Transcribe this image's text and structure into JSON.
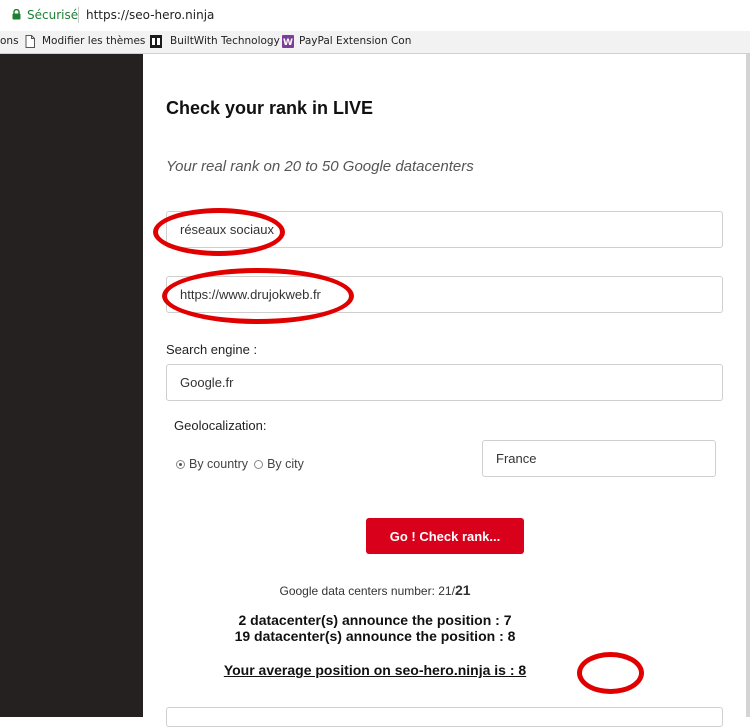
{
  "browser": {
    "secure_label": "Sécurisé",
    "url": "https://seo-hero.ninja",
    "bookmarks": [
      {
        "label": "ons",
        "icon": "none"
      },
      {
        "label": "Modifier les thèmes",
        "icon": "document-icon"
      },
      {
        "label": "BuiltWith Technology",
        "icon": "builtwith-icon"
      },
      {
        "label": "PayPal Extension Con",
        "icon": "paypal-extension-icon"
      }
    ]
  },
  "form": {
    "title": "Check your rank in LIVE",
    "subtitle": "Your real rank on 20 to 50 Google datacenters",
    "keyword_value": "réseaux sociaux",
    "site_value": "https://www.drujokweb.fr",
    "search_engine_label": "Search engine :",
    "search_engine_value": "Google.fr",
    "geoloc_label": "Geolocalization:",
    "radio_country": "By country",
    "radio_city": "By city",
    "country_value": "France",
    "submit_label": "Go ! Check rank..."
  },
  "results": {
    "dc_label": "Google data centers number: 21/",
    "dc_total": "21",
    "announce_1": "2 datacenter(s) announce the position : 7",
    "announce_2": "19 datacenter(s) announce the position : 8",
    "average": "Your average position on seo-hero.ninja is : 8"
  },
  "colors": {
    "accent": "#d9001b",
    "annotation": "#e00000",
    "sidebar": "#252121"
  }
}
